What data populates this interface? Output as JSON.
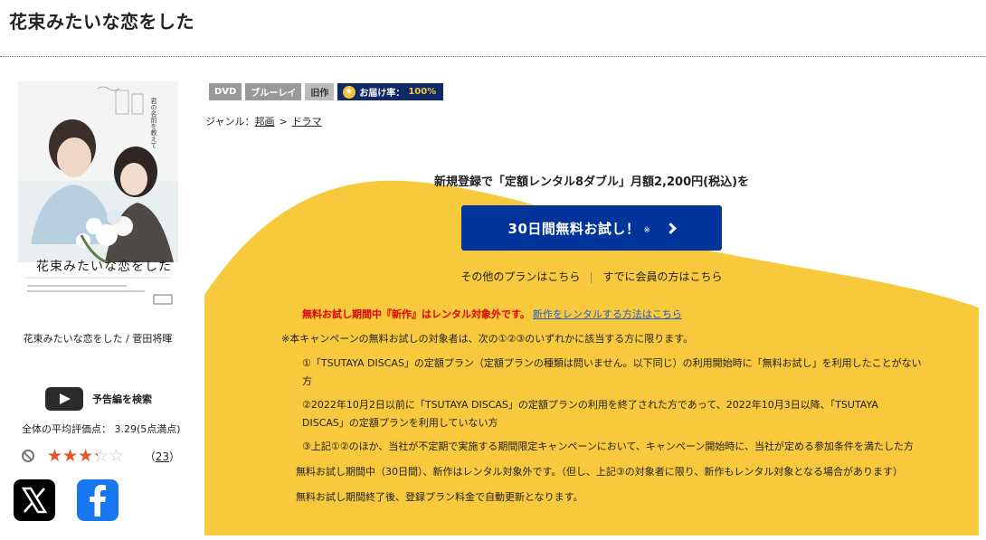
{
  "page": {
    "title": "花束みたいな恋をした"
  },
  "poster": {
    "title_art": "花束みたいな恋をした",
    "caption": "花束みたいな恋をした / 菅田将暉"
  },
  "trailer": {
    "label": "予告編を検索"
  },
  "rating": {
    "average_label": "全体の平均評価点： 3.29(5点満点)",
    "value": 3.29,
    "max": 5,
    "review_count": "23",
    "review_count_open": "（",
    "review_count_close": "）"
  },
  "badges": {
    "dvd": "DVD",
    "bluray": "ブルーレイ",
    "old": "旧作",
    "delivery_label": "お届け率：",
    "delivery_value": "100%"
  },
  "genre": {
    "label": "ジャンル：",
    "item1": "邦画",
    "separator": ">",
    "item2": "ドラマ"
  },
  "promo": {
    "headline": "新規登録で「定額レンタル8ダブル」月額2,200円(税込)を",
    "cta_label": "30日間無料お試し！",
    "cta_note": "※",
    "other_plans": "その他のプランはこちら",
    "member_login": "すでに会員の方はこちら"
  },
  "notes": {
    "red_notice": "無料お試し期間中『新作』はレンタル対象外です。",
    "red_link": "新作をレンタルする方法はこちら",
    "target_intro": "※本キャンペーンの無料お試しの対象者は、次の①②③のいずれかに該当する方に限ります。",
    "cond1_a": "①「TSUTAYA DISCAS」の定額プラン（定額プランの種類は問いません。以下同じ）の利用開始時に「無料お試し」を利用したことがない",
    "cond1_b": "方",
    "cond2_a": "②2022年10月2日以前に「TSUTAYA DISCAS」の定額プランの利用を終了された方であって、2022年10月3日以降、「TSUTAYA",
    "cond2_b": "DISCAS」の定額プランを利用していない方",
    "cond3": "③上記①②のほか、当社が不定期で実施する期間限定キャンペーンにおいて、キャンペーン開始時に、当社が定める参加条件を満たした方",
    "period_note": "無料お試し期間中（30日間）、新作はレンタル対象外です。（但し、上記③の対象者に限り、新作もレンタル対象となる場合があります）",
    "renewal_note": "無料お試し期間終了後、登録プラン料金で自動更新となります。"
  },
  "colors": {
    "accent_yellow": "#f8c93c",
    "cta_blue": "#00349a",
    "notice_red": "#e00000",
    "star_red": "#e8532c",
    "delivery_navy": "#0e2a66"
  }
}
